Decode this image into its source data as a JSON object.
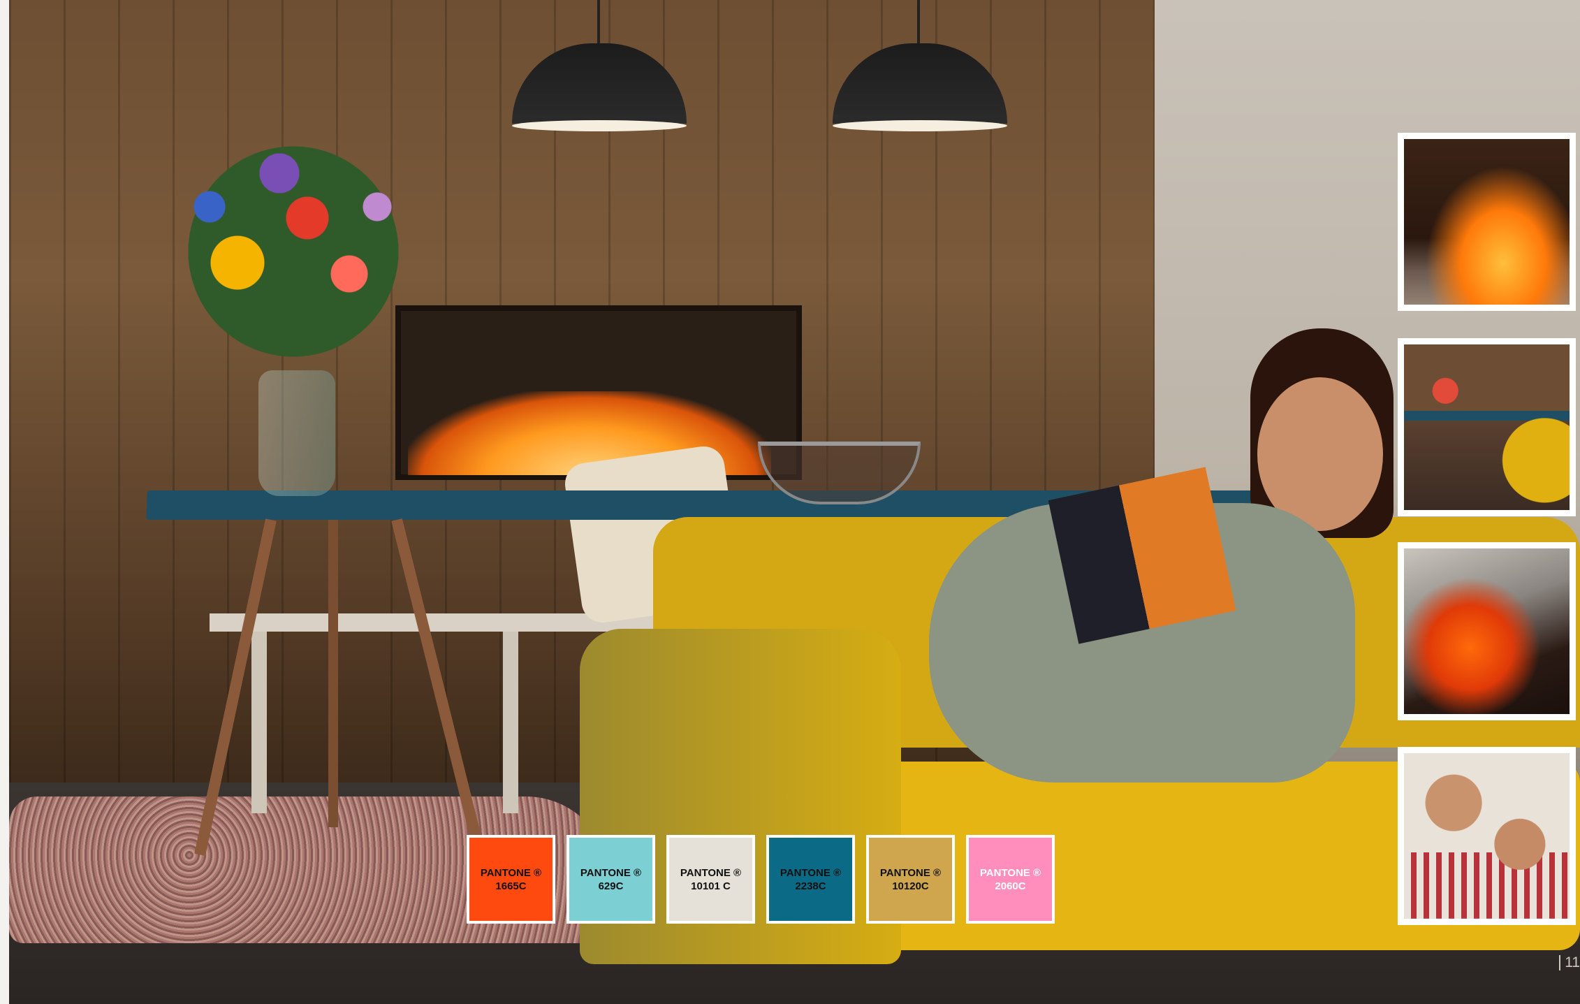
{
  "swatches": [
    {
      "label": "PANTONE ®\n1665C",
      "color": "#ff4a0f",
      "text_color": "#111111"
    },
    {
      "label": "PANTONE ®\n629C",
      "color": "#7ccfd3",
      "text_color": "#111111"
    },
    {
      "label": "PANTONE ®\n10101 C",
      "color": "#e5e1d9",
      "text_color": "#111111"
    },
    {
      "label": "PANTONE ®\n2238C",
      "color": "#0b6b86",
      "text_color": "#111111"
    },
    {
      "label": "PANTONE ®\n10120C",
      "color": "#cfa54e",
      "text_color": "#111111"
    },
    {
      "label": "PANTONE ®\n2060C",
      "color": "#ff8ebd",
      "text_color": "#ffffff"
    }
  ],
  "thumbnails": [
    "fireplace-flames-closeup",
    "dining-room-with-fireplace",
    "burning-logs-closeup",
    "woman-and-child-smiling"
  ],
  "page_number": "11"
}
